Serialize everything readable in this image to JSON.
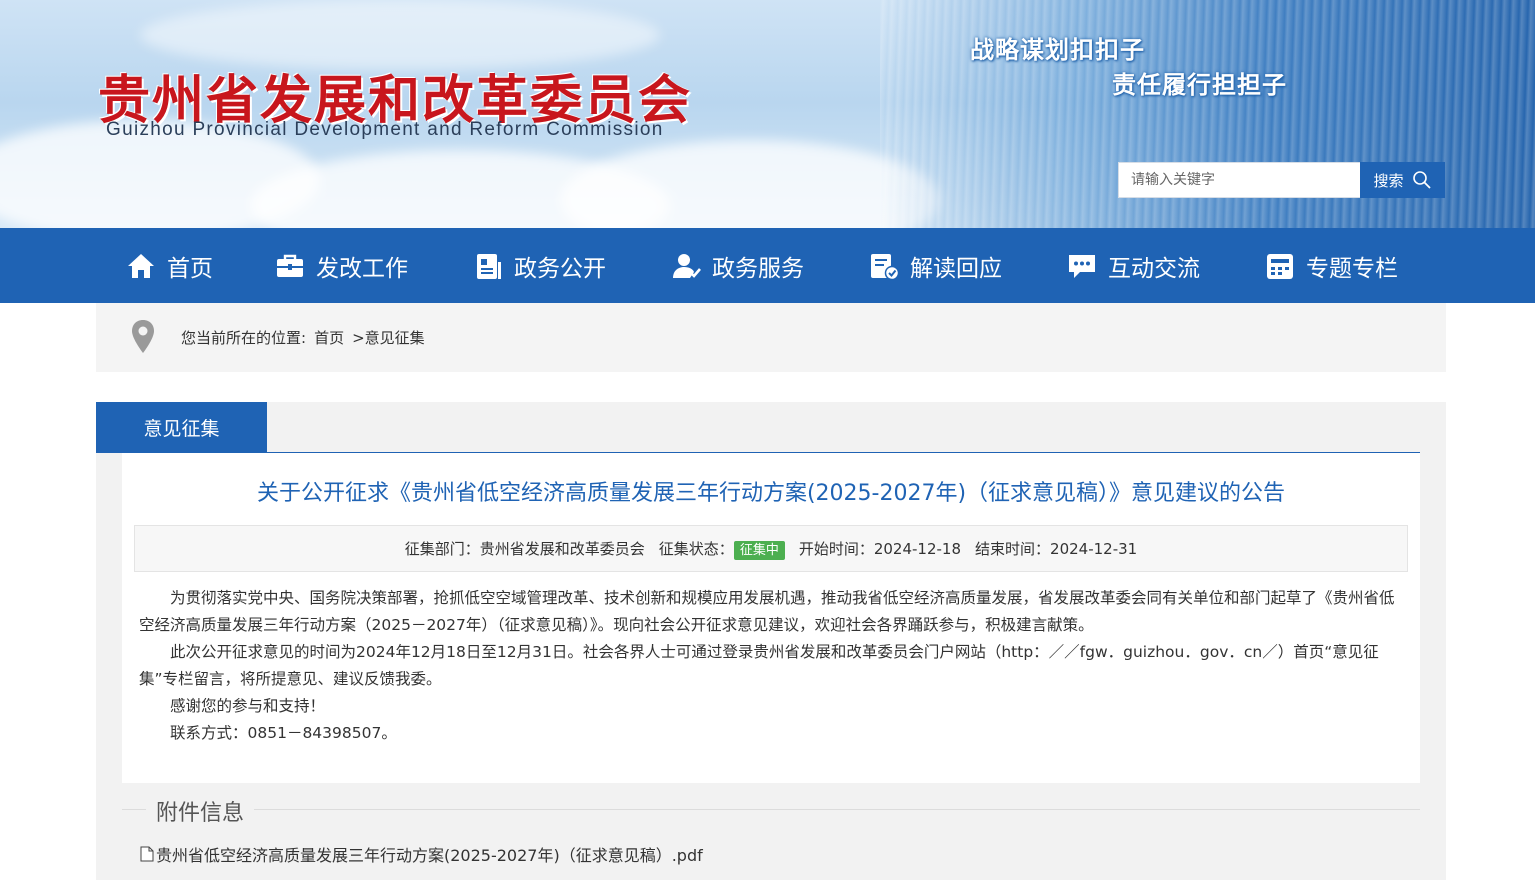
{
  "header": {
    "title": "贵州省发展和改革委员会",
    "subtitle": "Guizhou Provincial Development and Reform Commission",
    "slogan_line1": "战略谋划扣扣子",
    "slogan_line2": "责任履行担担子",
    "search_placeholder": "请输入关键字",
    "search_button": "搜索"
  },
  "nav": {
    "items": [
      {
        "label": "首页",
        "icon": "home-icon"
      },
      {
        "label": "发改工作",
        "icon": "briefcase-icon"
      },
      {
        "label": "政务公开",
        "icon": "document-icon"
      },
      {
        "label": "政务服务",
        "icon": "user-service-icon"
      },
      {
        "label": "解读回应",
        "icon": "reply-icon"
      },
      {
        "label": "互动交流",
        "icon": "chat-icon"
      },
      {
        "label": "专题专栏",
        "icon": "column-icon"
      }
    ]
  },
  "breadcrumb": {
    "prefix": "您当前所在的位置:",
    "home": "首页",
    "current": ">意见征集"
  },
  "panel": {
    "tab": "意见征集"
  },
  "article": {
    "title": "关于公开征求《贵州省低空经济高质量发展三年行动方案(2025-2027年)（征求意见稿）》意见建议的公告",
    "meta": {
      "dept_label": "征集部门：",
      "dept": "贵州省发展和改革委员会",
      "status_label": "征集状态：",
      "status": "征集中",
      "start_label": "开始时间：",
      "start": "2024-12-18",
      "end_label": "结束时间：",
      "end": "2024-12-31"
    },
    "paragraphs": [
      "为贯彻落实党中央、国务院决策部署，抢抓低空空域管理改革、技术创新和规模应用发展机遇，推动我省低空经济高质量发展，省发展改革委会同有关单位和部门起草了《贵州省低空经济高质量发展三年行动方案（2025－2027年）（征求意见稿）》。现向社会公开征求意见建议，欢迎社会各界踊跃参与，积极建言献策。",
      "此次公开征求意见的时间为2024年12月18日至12月31日。社会各界人士可通过登录贵州省发展和改革委员会门户网站（http：／／fgw．guizhou．gov．cn／）首页“意见征集”专栏留言，将所提意见、建议反馈我委。",
      "感谢您的参与和支持！",
      "联系方式：0851－84398507。"
    ]
  },
  "attachments": {
    "heading": "附件信息",
    "files": [
      "贵州省低空经济高质量发展三年行动方案(2025-2027年)（征求意见稿）.pdf"
    ]
  },
  "colors": {
    "brand_blue": "#1f63b4",
    "title_red": "#c8161d",
    "status_green": "#4caf50"
  }
}
